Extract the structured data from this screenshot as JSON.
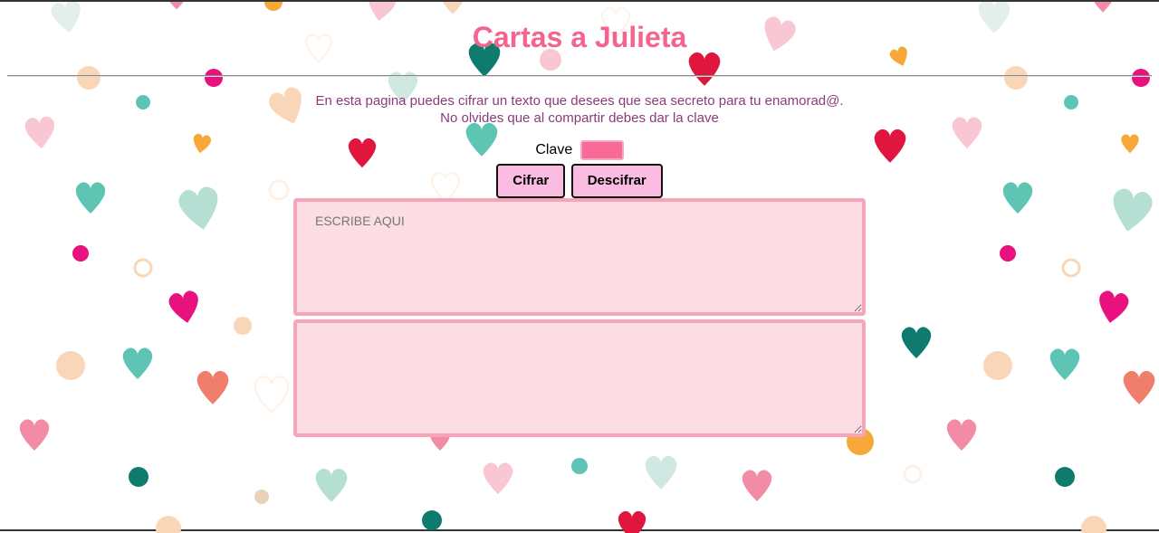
{
  "header": {
    "title": "Cartas a Julieta"
  },
  "intro": {
    "line1": "En esta pagina puedes cifrar un texto que desees que sea secreto para tu enamorad@.",
    "line2": "No olvides que al compartir debes dar la clave"
  },
  "key": {
    "label": "Clave",
    "value": ""
  },
  "actions": {
    "encrypt_label": "Cifrar",
    "decrypt_label": "Descifrar"
  },
  "input_area": {
    "placeholder": "ESCRIBE AQUI",
    "value": ""
  },
  "output_area": {
    "placeholder": "",
    "value": ""
  },
  "colors": {
    "title": "#f4648f",
    "intro_text": "#8b3b78",
    "key_field": "#f86a97",
    "button_bg": "#fbbce2",
    "textarea_bg": "#fddde4",
    "textarea_border": "#f7a3b8"
  },
  "background": {
    "pattern": "hearts-and-dots"
  }
}
